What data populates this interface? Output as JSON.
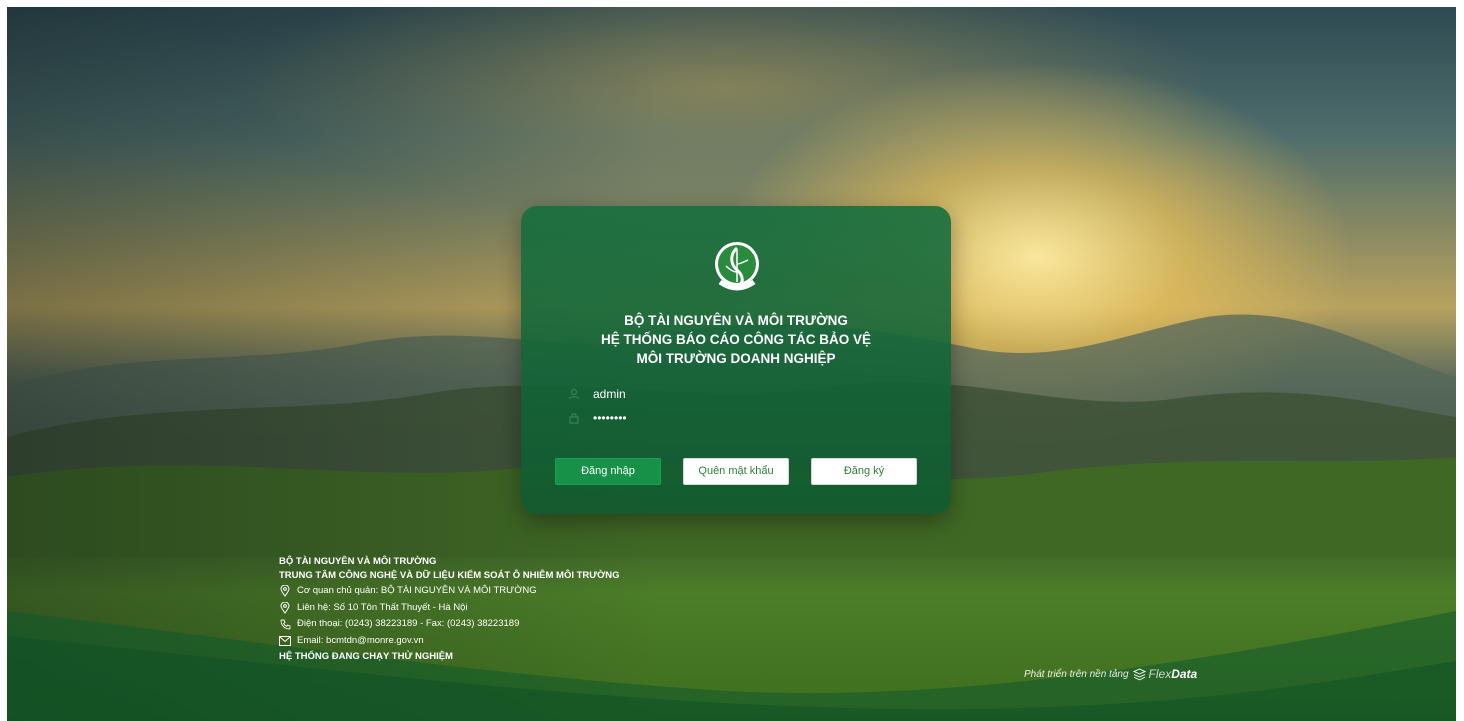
{
  "header": {
    "line1": "BỘ TÀI NGUYÊN VÀ MÔI TRƯỜNG",
    "line2": "HỆ THỐNG BÁO CÁO CÔNG TÁC BẢO VỆ",
    "line3": "MÔI TRƯỜNG DOANH NGHIỆP"
  },
  "login": {
    "username_value": "admin",
    "password_value": "••••••••",
    "login_label": "Đăng nhập",
    "forgot_label": "Quên mật khẩu",
    "register_label": "Đăng ký"
  },
  "footer": {
    "org": "BỘ TÀI NGUYÊN VÀ MÔI TRƯỜNG",
    "center": "TRUNG TÂM CÔNG NGHỆ VÀ DỮ LIỆU KIỂM SOÁT Ô NHIỄM MÔI TRƯỜNG",
    "agency": "Cơ quan chủ quản: BỘ TÀI NGUYÊN VÀ MÔI TRƯỜNG",
    "contact": "Liên hệ: Số 10 Tôn Thất Thuyết - Hà Nội",
    "phone": "Điện thoại: (0243) 38223189 - Fax: (0243) 38223189",
    "email": "Email: bcmtdn@monre.gov.vn",
    "status": "HỆ THỐNG ĐANG CHẠY THỬ NGHIỆM"
  },
  "powered": {
    "text": "Phát triển trên nền tảng",
    "brand_light": "Flex",
    "brand_bold": "Data"
  },
  "icons": {
    "user": "user-icon",
    "lock": "lock-icon",
    "location": "location-pin-icon",
    "phone": "phone-icon",
    "mail": "mail-icon",
    "brand": "flexdata-logo-icon"
  },
  "colors": {
    "card_green": "#0e5a30",
    "button_green": "#169147",
    "button_text_green": "#2f7d3b"
  }
}
